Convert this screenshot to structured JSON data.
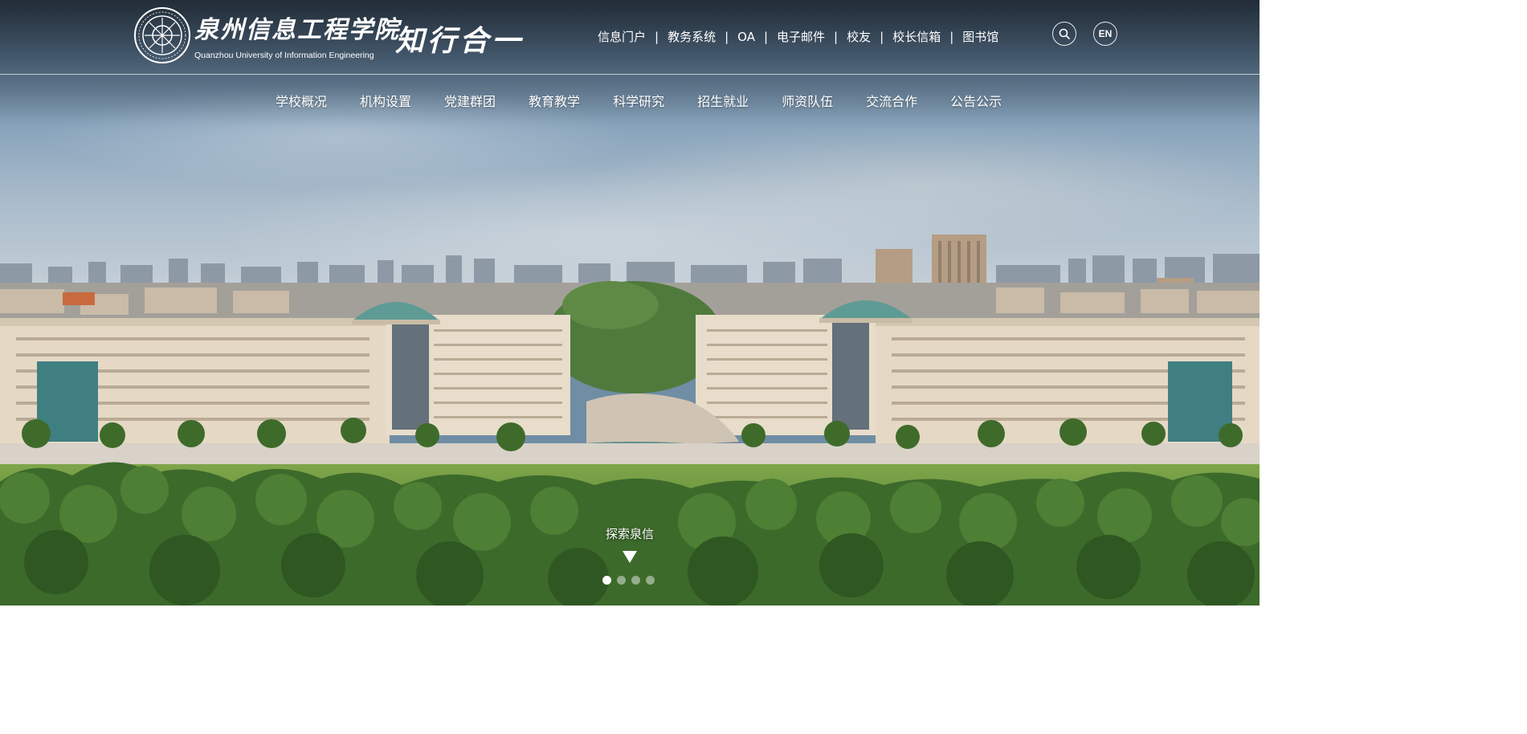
{
  "header": {
    "logo_cn": "泉州信息工程学院",
    "logo_en": "Quanzhou University of Information Engineering",
    "motto": "知行合一",
    "quick_links": [
      "信息门户",
      "教务系统",
      "OA",
      "电子邮件",
      "校友",
      "校长信箱",
      "图书馆"
    ],
    "quick_link_separator": "|",
    "search_icon": "search-icon",
    "lang_label": "EN"
  },
  "nav": {
    "items": [
      "学校概况",
      "机构设置",
      "党建群团",
      "教育教学",
      "科学研究",
      "招生就业",
      "师资队伍",
      "交流合作",
      "公告公示"
    ]
  },
  "hero": {
    "explore_label": "探索泉信",
    "arrow_icon": "down-arrow-icon",
    "slide_count": 4,
    "active_slide": 1
  },
  "colors": {
    "text": "#ffffff",
    "dome": "#5f9b95",
    "building": "#e3d6c2"
  }
}
